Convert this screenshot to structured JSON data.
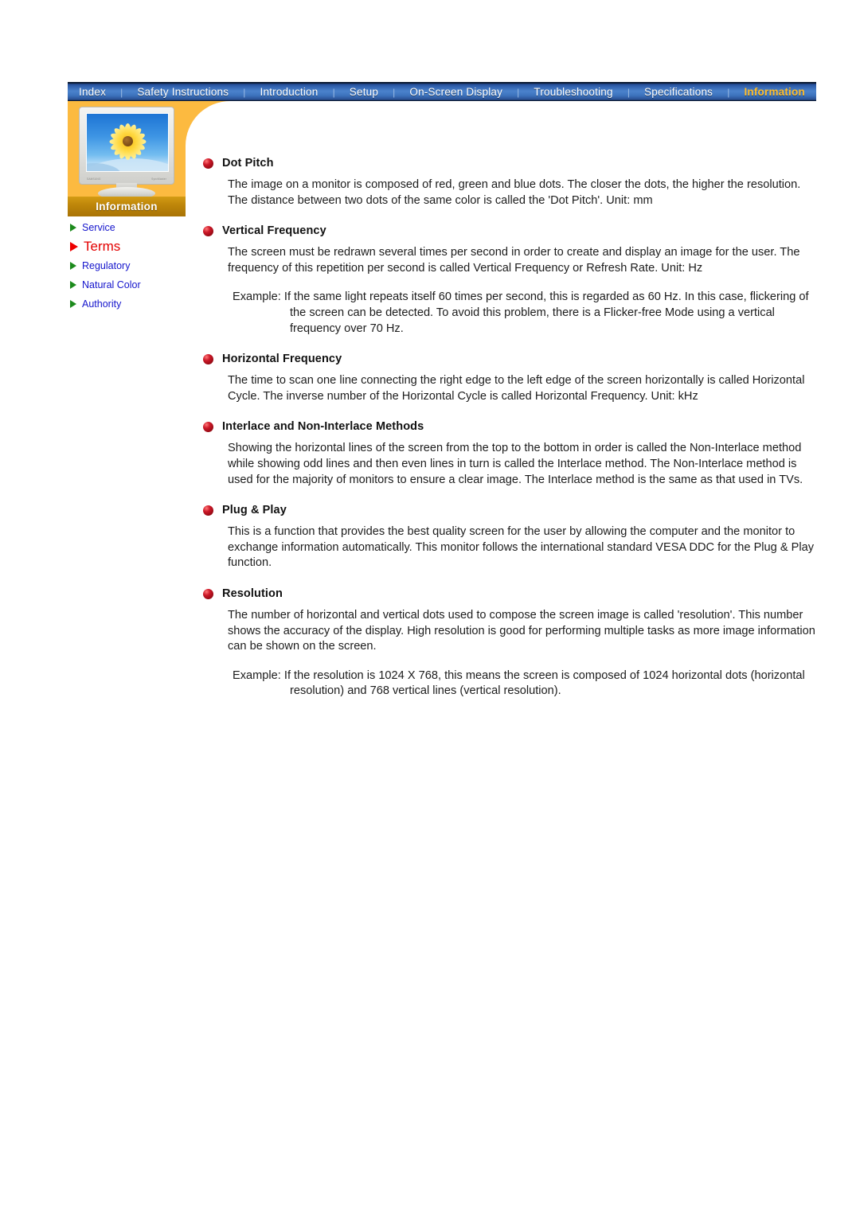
{
  "navbar": {
    "separator": "|",
    "items": [
      {
        "label": "Index",
        "active": false
      },
      {
        "label": "Safety Instructions",
        "active": false
      },
      {
        "label": "Introduction",
        "active": false
      },
      {
        "label": "Setup",
        "active": false
      },
      {
        "label": "On-Screen Display",
        "active": false
      },
      {
        "label": "Troubleshooting",
        "active": false
      },
      {
        "label": "Specifications",
        "active": false
      },
      {
        "label": "Information",
        "active": true
      }
    ]
  },
  "sidebar": {
    "section_label": "Information",
    "monitor_brand_left": "SAMSUNG",
    "monitor_brand_right": "SyncMaster",
    "items": [
      {
        "label": "Service",
        "active": false
      },
      {
        "label": "Terms",
        "active": true
      },
      {
        "label": "Regulatory",
        "active": false
      },
      {
        "label": "Natural Color",
        "active": false
      },
      {
        "label": "Authority",
        "active": false
      }
    ]
  },
  "content": {
    "sections": [
      {
        "title": "Dot Pitch",
        "body": "The image on a monitor is composed of red, green and blue dots. The closer the dots, the higher the resolution. The distance between two dots of the same color is called the 'Dot Pitch'. Unit: mm",
        "example": null
      },
      {
        "title": "Vertical Frequency",
        "body": "The screen must be redrawn several times per second in order to create and display an image for the user. The frequency of this repetition per second is called Vertical Frequency or Refresh Rate. Unit: Hz",
        "example": "Example: If the same light repeats itself 60 times per second, this is regarded as 60 Hz. In this case, flickering of the screen can be detected. To avoid this problem, there is a Flicker-free Mode using a vertical frequency over 70 Hz."
      },
      {
        "title": "Horizontal Frequency",
        "body": "The time to scan one line connecting the right edge to the left edge of the screen horizontally is called Horizontal Cycle. The inverse number of the Horizontal Cycle is called Horizontal Frequency. Unit: kHz",
        "example": null
      },
      {
        "title": "Interlace and Non-Interlace Methods",
        "body": "Showing the horizontal lines of the screen from the top to the bottom in order is called the Non-Interlace method while showing odd lines and then even lines in turn is called the Interlace method. The Non-Interlace method is used for the majority of monitors to ensure a clear image. The Interlace method is the same as that used in TVs.",
        "example": null
      },
      {
        "title": "Plug & Play",
        "body": "This is a function that provides the best quality screen for the user by allowing the computer and the monitor to exchange information automatically. This monitor follows the international standard VESA DDC for the Plug & Play function.",
        "example": null
      },
      {
        "title": "Resolution",
        "body": "The number of horizontal and vertical dots used to compose the screen image is called 'resolution'. This number shows the accuracy of the display. High resolution is good for performing multiple tasks as more image information can be shown on the screen.",
        "example": "Example: If the resolution is 1024 X 768, this means the screen is composed of 1024 horizontal dots (horizontal resolution) and 768 vertical lines (vertical resolution)."
      }
    ]
  },
  "colors": {
    "nav_active": "#ffbe2e",
    "panel_orange": "#fcba40",
    "info_bar_brown": "#bd8509",
    "link_blue": "#1414cc",
    "active_red": "#e30000",
    "bullet_red": "#900812",
    "triangle_green": "#1c8a1c"
  }
}
